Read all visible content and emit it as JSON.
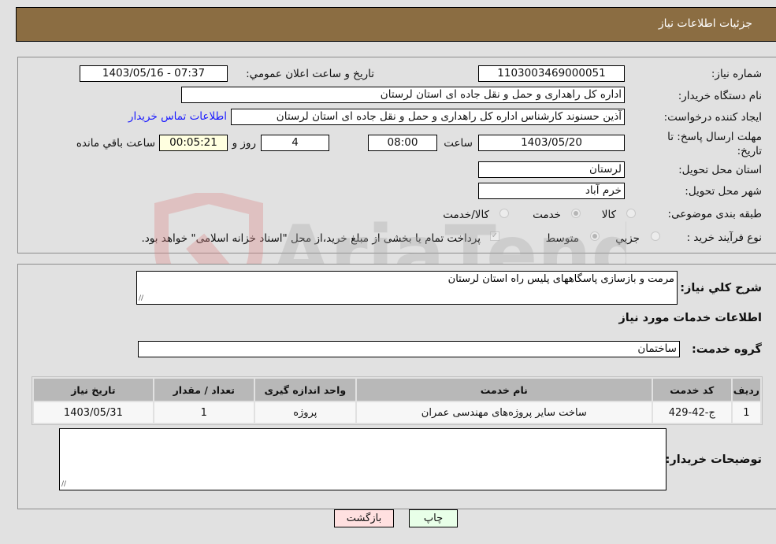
{
  "header": {
    "title": "جزئیات اطلاعات نیاز"
  },
  "fields": {
    "need_number": {
      "label": "شماره نیاز:",
      "value": "1103003469000051"
    },
    "announce_datetime": {
      "label": "تاریخ و ساعت اعلان عمومي:",
      "value": "1403/05/16 - 07:37"
    },
    "buyer_org": {
      "label": "نام دستگاه خریدار:",
      "value": "اداره کل راهداری و حمل و نقل جاده ای استان لرستان"
    },
    "requester": {
      "label": "ایجاد کننده درخواست:",
      "value": "آذین حسنوند کارشناس اداره کل راهداری و حمل و نقل جاده ای استان لرستان",
      "contact_link": "اطلاعات تماس خریدار"
    },
    "deadline": {
      "label_line1": "مهلت ارسال پاسخ: تا",
      "label_line2": "تاریخ:",
      "date": "1403/05/20",
      "time_label": "ساعت",
      "time": "08:00",
      "days": "4",
      "days_label": "روز و",
      "remaining": "00:05:21",
      "remaining_label": "ساعت باقي مانده"
    },
    "delivery_province": {
      "label": "استان محل تحویل:",
      "value": "لرستان"
    },
    "delivery_city": {
      "label": "شهر محل تحویل:",
      "value": "خرم آباد"
    },
    "category": {
      "label": "طبقه بندی موضوعی:",
      "options": [
        "کالا",
        "خدمت",
        "کالا/خدمت"
      ],
      "selected": "خدمت"
    },
    "purchase_type": {
      "label": "نوع فرآیند خرید :",
      "options": [
        "جزیي",
        "متوسط"
      ],
      "selected": "متوسط",
      "treasury_note": "پرداخت تمام یا بخشی از مبلغ خرید،از محل \"اسناد خزانه اسلامی\" خواهد بود.",
      "treasury_checked": true
    }
  },
  "description": {
    "label": "شرح کلي نیاز:",
    "value": "مرمت و بازسازی پاسگاههای پلیس راه استان لرستان"
  },
  "services_section": {
    "title": "اطلاعات خدمات مورد نیاز",
    "group_label": "گروه خدمت:",
    "group_value": "ساختمان",
    "table": {
      "headers": [
        "ردیف",
        "کد خدمت",
        "نام خدمت",
        "واحد اندازه گیری",
        "تعداد / مقدار",
        "تاریخ نیاز"
      ],
      "rows": [
        [
          "1",
          "ج-42-429",
          "ساخت سایر پروژه‌های مهندسی عمران",
          "پروژه",
          "1",
          "1403/05/31"
        ]
      ]
    }
  },
  "buyer_notes": {
    "label": "توضیحات خریدار:",
    "value": ""
  },
  "buttons": {
    "print": "چاپ",
    "back": "بازگشت"
  },
  "watermark": {
    "text": "AriaTender.net"
  }
}
